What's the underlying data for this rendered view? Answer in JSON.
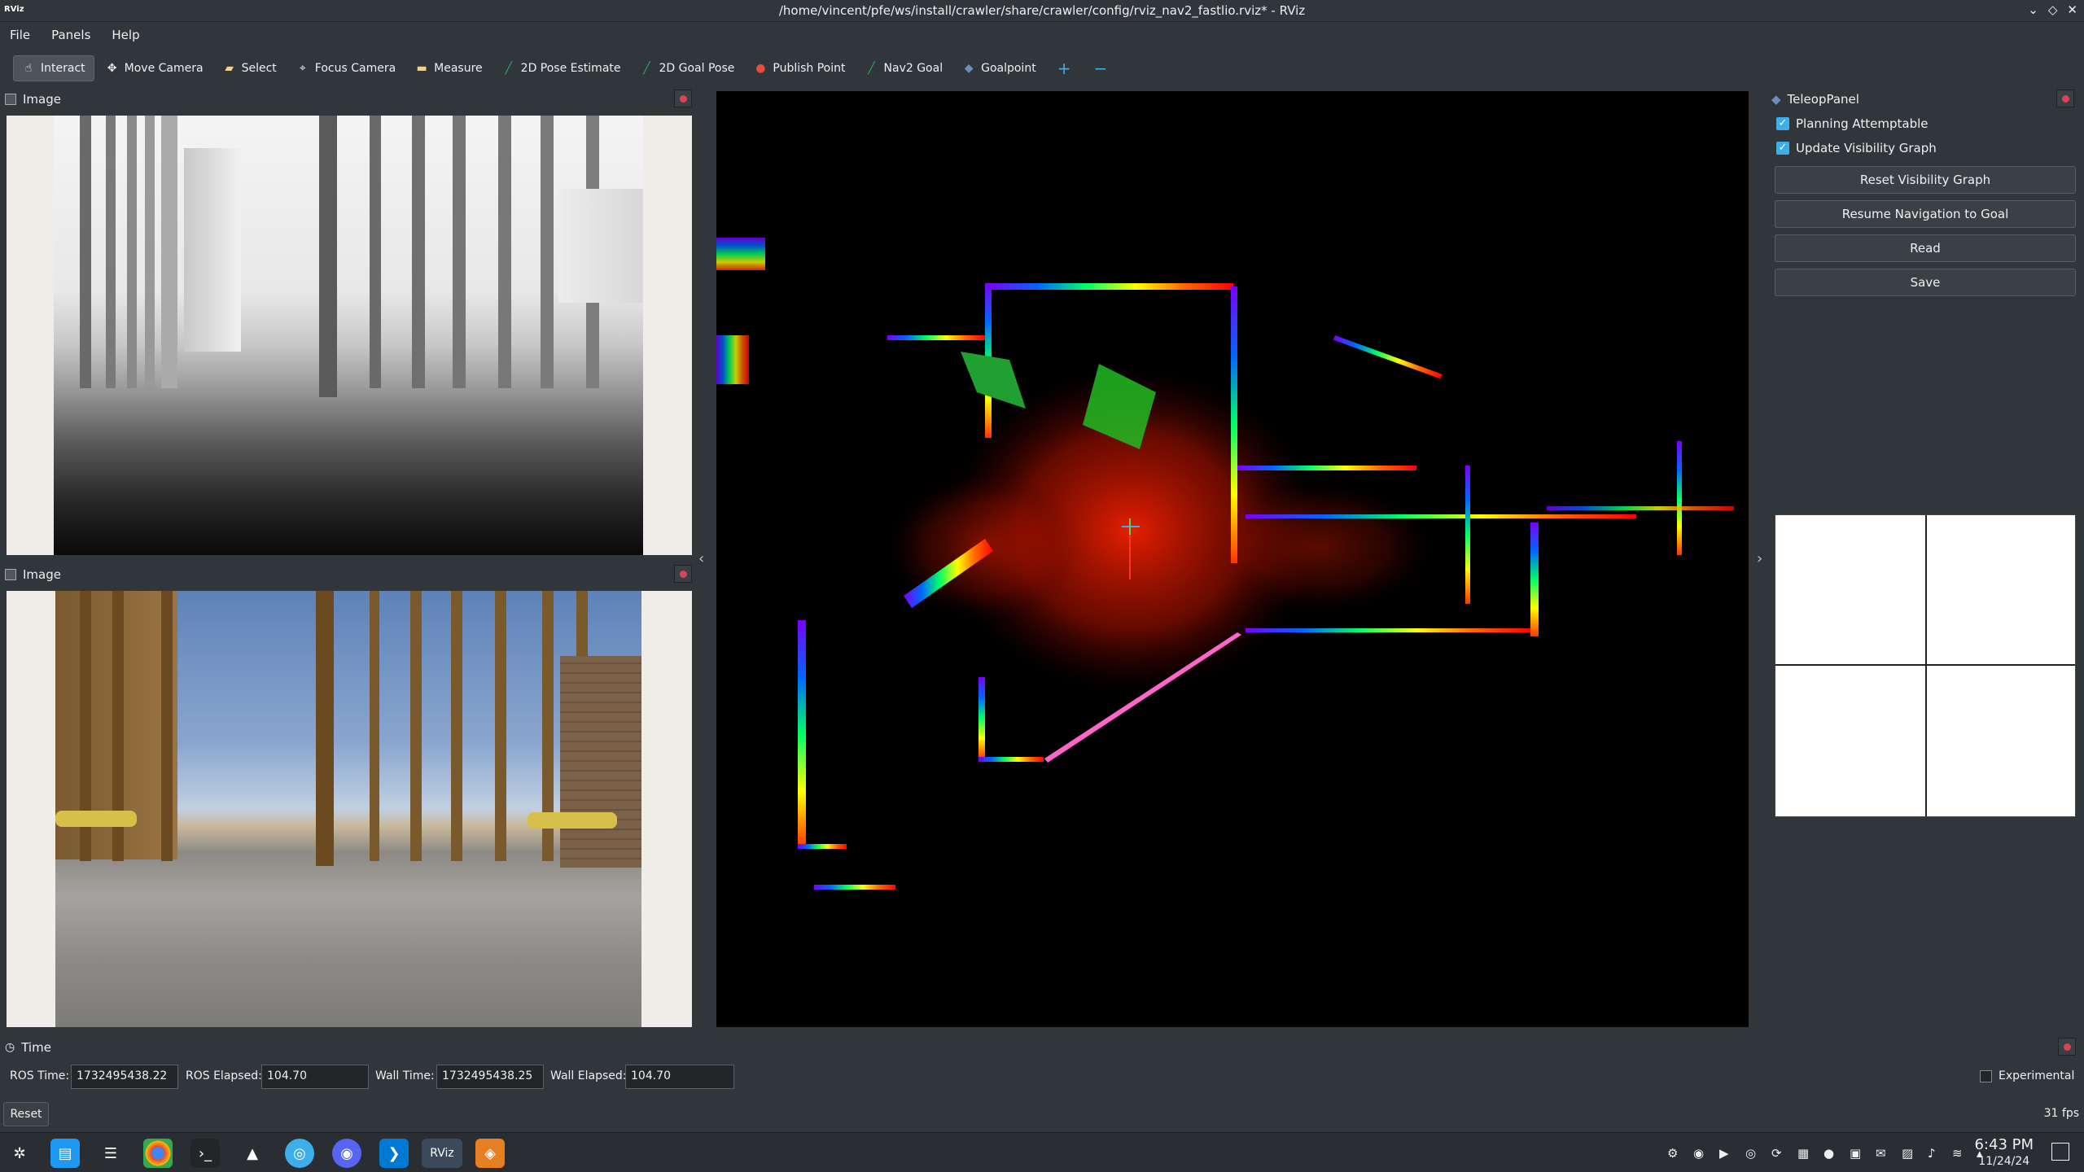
{
  "window": {
    "app_icon": "RViz",
    "title": "/home/vincent/pfe/ws/install/crawler/share/crawler/config/rviz_nav2_fastlio.rviz* - RViz",
    "controls": [
      "minimize-icon",
      "maximize-icon",
      "close-icon"
    ]
  },
  "menu": {
    "file": "File",
    "panels": "Panels",
    "help": "Help"
  },
  "toolbar": {
    "interact": "Interact",
    "move_camera": "Move Camera",
    "select": "Select",
    "focus_camera": "Focus Camera",
    "measure": "Measure",
    "pose_estimate": "2D Pose Estimate",
    "goal_pose": "2D Goal Pose",
    "publish_point": "Publish Point",
    "nav2_goal": "Nav2 Goal",
    "goalpoint": "Goalpoint",
    "add": "+",
    "remove": "−"
  },
  "panels": {
    "image_top": {
      "title": "Image"
    },
    "image_bottom": {
      "title": "Image"
    },
    "teleop": {
      "title": "TeleopPanel",
      "check_planning": "Planning Attemptable",
      "check_update": "Update Visibility Graph",
      "btn_reset": "Reset Visibility Graph",
      "btn_resume": "Resume Navigation to Goal",
      "btn_read": "Read",
      "btn_save": "Save"
    }
  },
  "time": {
    "title": "Time",
    "ros_time_label": "ROS Time:",
    "ros_time": "1732495438.22",
    "ros_elapsed_label": "ROS Elapsed:",
    "ros_elapsed": "104.70",
    "wall_time_label": "Wall Time:",
    "wall_time": "1732495438.25",
    "wall_elapsed_label": "Wall Elapsed:",
    "wall_elapsed": "104.70",
    "experimental": "Experimental"
  },
  "status": {
    "reset": "Reset",
    "fps": "31 fps"
  },
  "taskbar": {
    "time": "6:43 PM",
    "date": "11/24/24",
    "rviz_label": "RViz"
  }
}
